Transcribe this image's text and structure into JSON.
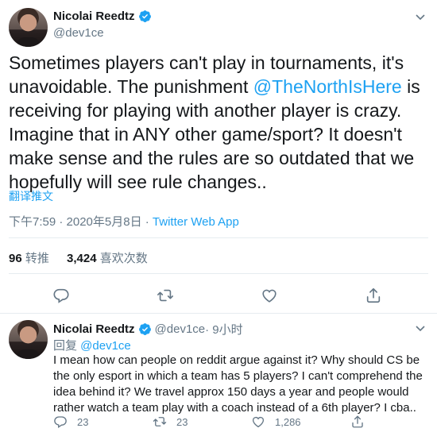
{
  "tweet": {
    "author_name": "Nicolai Reedtz",
    "author_handle": "@dev1ce",
    "text_before": "Sometimes players can't play in tournaments, it's unavoidable. The punishment ",
    "mention": "@TheNorthIsHere",
    "text_after": " is receiving for playing with another player is crazy. Imagine that in ANY other game/sport? It doesn't make sense and the rules are so outdated that we hopefully will see rule changes..",
    "translate_label": "翻译推文",
    "timestamp": "下午7:59 · 2020年5月8日 · ",
    "source_app": "Twitter Web App",
    "retweets_count": "96",
    "retweets_label": "转推",
    "likes_count": "3,424",
    "likes_label": "喜欢次数"
  },
  "reply": {
    "author_name": "Nicolai Reedtz",
    "author_handle": "@dev1ce",
    "time": " · 9小时",
    "replying_label": "回复 ",
    "replying_to": "@dev1ce",
    "text": "I mean how can people on reddit argue against it? Why should CS be the only esport in which a team has 5 players? I can't comprehend the idea behind it? We travel approx 150 days a year and people would rather watch a team play with a coach instead of a 6th player? I cba..",
    "reply_count": "23",
    "retweet_count": "23",
    "like_count": "1,286"
  },
  "colors": {
    "accent": "#1da1f2",
    "secondary_text": "#657786",
    "divider": "#e6ecf0"
  },
  "icons": [
    "chevron-down-icon",
    "verified-badge-icon",
    "reply-icon",
    "retweet-icon",
    "like-icon",
    "share-icon"
  ]
}
